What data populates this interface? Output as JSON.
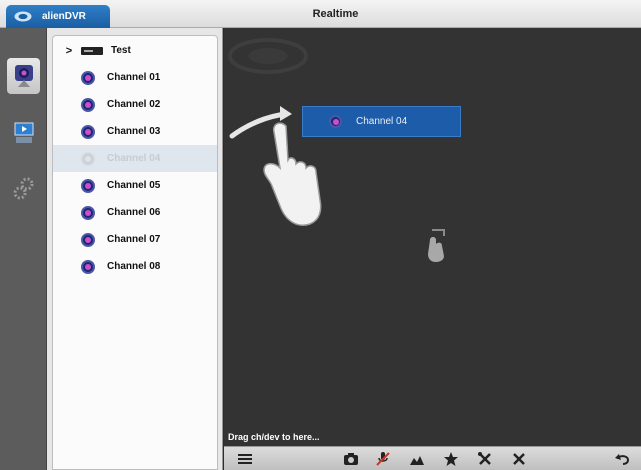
{
  "topbar": {
    "app_name": "alienDVR",
    "title": "Realtime"
  },
  "rail": {
    "items": [
      {
        "name": "realtime",
        "icon": "camera-icon",
        "active": true
      },
      {
        "name": "playback",
        "icon": "playback-icon",
        "active": false
      },
      {
        "name": "settings",
        "icon": "gears-icon",
        "active": false
      }
    ]
  },
  "device_tree": {
    "device": {
      "label": "Test",
      "icon": "dvr-device-icon"
    },
    "channels": [
      {
        "label": "Channel 01",
        "selected": false
      },
      {
        "label": "Channel 02",
        "selected": false
      },
      {
        "label": "Channel 03",
        "selected": false
      },
      {
        "label": "Channel 04",
        "selected": true
      },
      {
        "label": "Channel 05",
        "selected": false
      },
      {
        "label": "Channel 06",
        "selected": false
      },
      {
        "label": "Channel 07",
        "selected": false
      },
      {
        "label": "Channel 08",
        "selected": false
      }
    ]
  },
  "viewport": {
    "dragging_label": "Channel 04",
    "hint": "Drag ch/dev to here..."
  },
  "toolbar": {
    "buttons": [
      {
        "name": "layout",
        "icon": "layout-icon"
      },
      {
        "name": "snapshot",
        "icon": "camera-snapshot-icon"
      },
      {
        "name": "mute",
        "icon": "mic-mute-icon"
      },
      {
        "name": "ptz",
        "icon": "ptz-icon"
      },
      {
        "name": "favorite",
        "icon": "star-icon"
      },
      {
        "name": "tools",
        "icon": "tools-icon"
      },
      {
        "name": "close-all",
        "icon": "close-icon"
      },
      {
        "name": "back",
        "icon": "back-icon"
      }
    ]
  },
  "colors": {
    "accent": "#1d5ca8",
    "viewport_bg": "#333333",
    "rail_bg": "#5c5c5c"
  }
}
